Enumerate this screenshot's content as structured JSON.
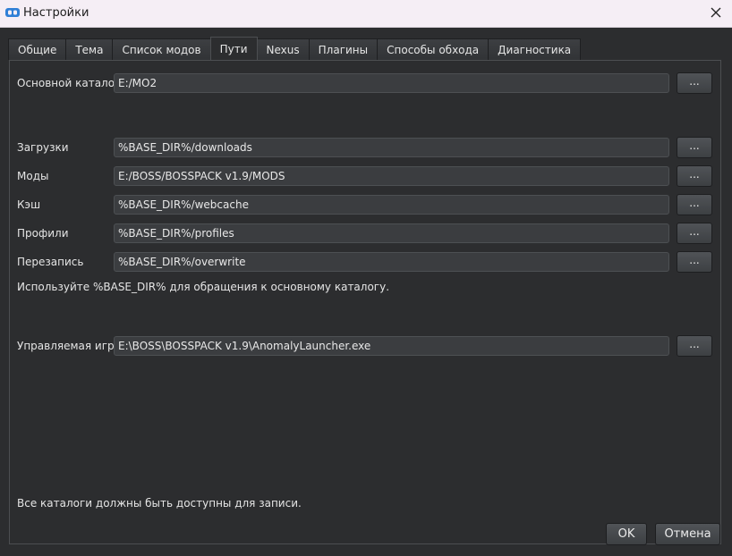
{
  "window": {
    "title": "Настройки"
  },
  "tabs": [
    {
      "label": "Общие"
    },
    {
      "label": "Тема"
    },
    {
      "label": "Список модов"
    },
    {
      "label": "Пути",
      "active": true
    },
    {
      "label": "Nexus"
    },
    {
      "label": "Плагины"
    },
    {
      "label": "Способы обхода"
    },
    {
      "label": "Диагностика"
    }
  ],
  "paths": {
    "base": {
      "label": "Основной каталог",
      "value": "E:/MO2"
    },
    "downloads": {
      "label": "Загрузки",
      "value": "%BASE_DIR%/downloads"
    },
    "mods": {
      "label": "Моды",
      "value": "E:/BOSS/BOSSPACK v1.9/MODS"
    },
    "cache": {
      "label": "Кэш",
      "value": "%BASE_DIR%/webcache"
    },
    "profiles": {
      "label": "Профили",
      "value": "%BASE_DIR%/profiles"
    },
    "overwrite": {
      "label": "Перезапись",
      "value": "%BASE_DIR%/overwrite"
    },
    "hint": "Используйте %BASE_DIR% для обращения к основному каталогу.",
    "managed_game": {
      "label": "Управляемая игра",
      "value": "E:\\BOSS\\BOSSPACK v1.9\\AnomalyLauncher.exe"
    },
    "footer_note": "Все каталоги должны быть доступны для записи.",
    "browse_label": "..."
  },
  "buttons": {
    "ok": "OK",
    "cancel": "Отмена"
  },
  "colors": {
    "background": "#2c2d2f",
    "field": "#3b3d40",
    "titlebar": "#f5eef5",
    "icon_accent": "#2f7fd6"
  }
}
